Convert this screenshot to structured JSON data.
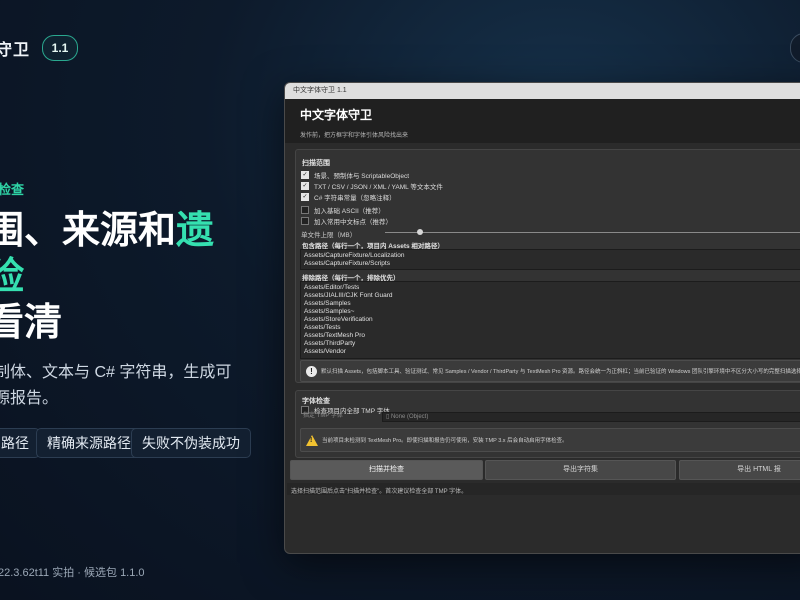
{
  "landing": {
    "brand": "守卫",
    "version": "1.1",
    "eyebrow": "检查",
    "headline": {
      "line1_a": "围、来源和",
      "line1_b": "遗",
      "line2": "险",
      "line3": "看清"
    },
    "lead": {
      "line1": "制体、文本与 C# 字符串，生成可",
      "line2": "源报告。"
    },
    "chips": [
      "路径",
      "精确来源路径",
      "失败不伪装成功"
    ],
    "footnote": "22.3.62t11 实拍 · 候选包 1.1.0"
  },
  "window": {
    "titlebar": "中文字体守卫 1.1",
    "title": "中文字体守卫",
    "subtitle": "发作前，把方框字和字体引体风险找出来",
    "scan": {
      "section_title": "扫描范围",
      "options": [
        {
          "label": "场景、预制体与 ScriptableObject",
          "checked": true
        },
        {
          "label": "TXT / CSV / JSON / XML / YAML 等文本文件",
          "checked": true
        },
        {
          "label": "C# 字符串常量（忽略注释）",
          "checked": true
        },
        {
          "label": "加入基础 ASCII（推荐）",
          "checked": false
        },
        {
          "label": "加入常用中文标点（推荐）",
          "checked": false
        }
      ],
      "slider_label": "单文件上限（MB）",
      "slider_level": 0.08,
      "include_label": "包含路径（每行一个，项目内 Assets 相对路径）",
      "include_paths": [
        "Assets/CaptureFixture/Localization",
        "Assets/CaptureFixture/Scripts"
      ],
      "exclude_label": "排除路径（每行一个，排除优先）",
      "exclude_paths": [
        "Assets/Editor/Tests",
        "Assets/JIALIII/CJK Font Guard",
        "Assets/Samples",
        "Assets/Samples~",
        "Assets/StoreVerification",
        "Assets/Tests",
        "Assets/TextMesh Pro",
        "Assets/ThirdParty",
        "Assets/Vendor"
      ],
      "info_text": "默认扫描 Assets，包括脚本工具、验证测试、常见 Samples / Vendor / ThirdParty 与 TextMesh Pro 资源。路径会统一为正斜杠；当前已验证的 Windows 团队引擎环境中不区分大小写的完整扫描选择列表"
    },
    "font_check": {
      "section_title": "字体检查",
      "option": {
        "label": "检查项目内全部 TMP 字体",
        "checked": false
      },
      "field_label": "指定 TMP 字体",
      "field_value": "None (Object)",
      "warning_text": "当前项目未检测到 TextMesh Pro。即使扫描和报告仍可使用，安装 TMP 3.x 后会自动启用字体检查。"
    },
    "actions": {
      "scan": "扫描并检查",
      "export_charset": "导出字符集",
      "export_html": "导出 HTML 报"
    },
    "status": "选择扫描范围后点击\"扫描并检查\"。首次建议检查全部 TMP 字体。"
  }
}
